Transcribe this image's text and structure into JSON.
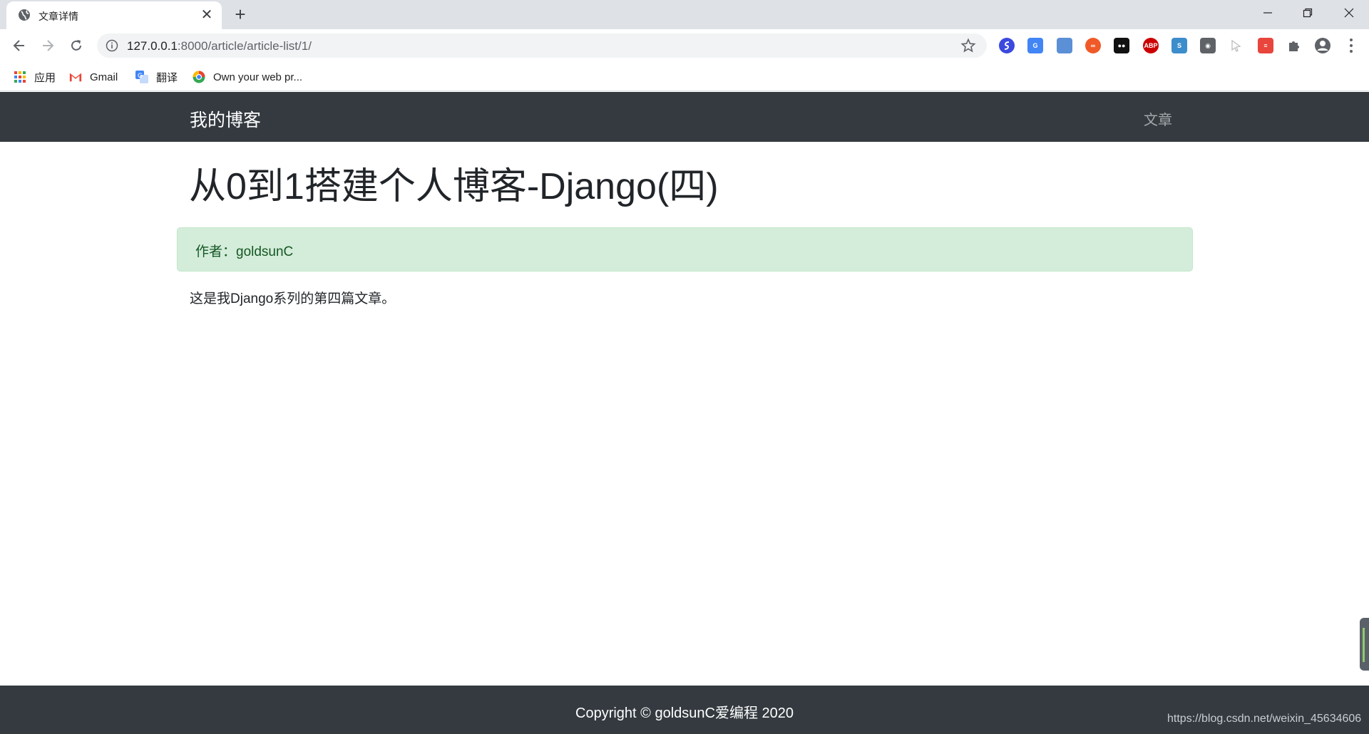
{
  "browser": {
    "tab": {
      "title": "文章详情"
    },
    "address": {
      "host": "127.0.0.1",
      "path": ":8000/article/article-list/1/"
    },
    "bookmarks": [
      {
        "label": "应用",
        "icon": "apps-grid-icon"
      },
      {
        "label": "Gmail",
        "icon": "gmail-icon"
      },
      {
        "label": "翻译",
        "icon": "google-translate-icon"
      },
      {
        "label": "Own your web pr...",
        "icon": "chrome-like-icon"
      }
    ],
    "extensions": [
      {
        "name": "ext-blue-s-icon",
        "color": "#3b49df",
        "text": ""
      },
      {
        "name": "ext-translate-icon",
        "color": "#4285f4",
        "text": "G"
      },
      {
        "name": "ext-image-icon",
        "color": "#5b8fd6",
        "text": ""
      },
      {
        "name": "ext-infinity-icon",
        "color": "#f05a28",
        "text": "∞"
      },
      {
        "name": "ext-tampermonkey-icon",
        "color": "#111111",
        "text": "●●"
      },
      {
        "name": "ext-adblock-icon",
        "color": "#cc0000",
        "text": "ABP"
      },
      {
        "name": "ext-s-icon",
        "color": "#3c8dcc",
        "text": "S"
      },
      {
        "name": "ext-owl-icon",
        "color": "#5f6368",
        "text": "◉"
      },
      {
        "name": "ext-cursor-icon",
        "color": "#bdbdbd",
        "text": ""
      },
      {
        "name": "ext-reader-icon",
        "color": "#e8453c",
        "text": "≡"
      },
      {
        "name": "extensions-puzzle-icon",
        "color": "#5f6368",
        "text": ""
      },
      {
        "name": "profile-avatar-icon",
        "color": "#5f6368",
        "text": ""
      }
    ]
  },
  "site": {
    "brand": "我的博客",
    "nav_link": "文章"
  },
  "article": {
    "title": "从0到1搭建个人博客-Django(四)",
    "author_line": "作者：goldsunC",
    "body": "这是我Django系列的第四篇文章。"
  },
  "footer": {
    "copyright": "Copyright © goldsunC爱编程 2020"
  },
  "watermark": "https://blog.csdn.net/weixin_45634606",
  "colors": {
    "navbar_bg": "#343a40",
    "alert_bg": "#d4edda",
    "alert_text": "#155724"
  }
}
